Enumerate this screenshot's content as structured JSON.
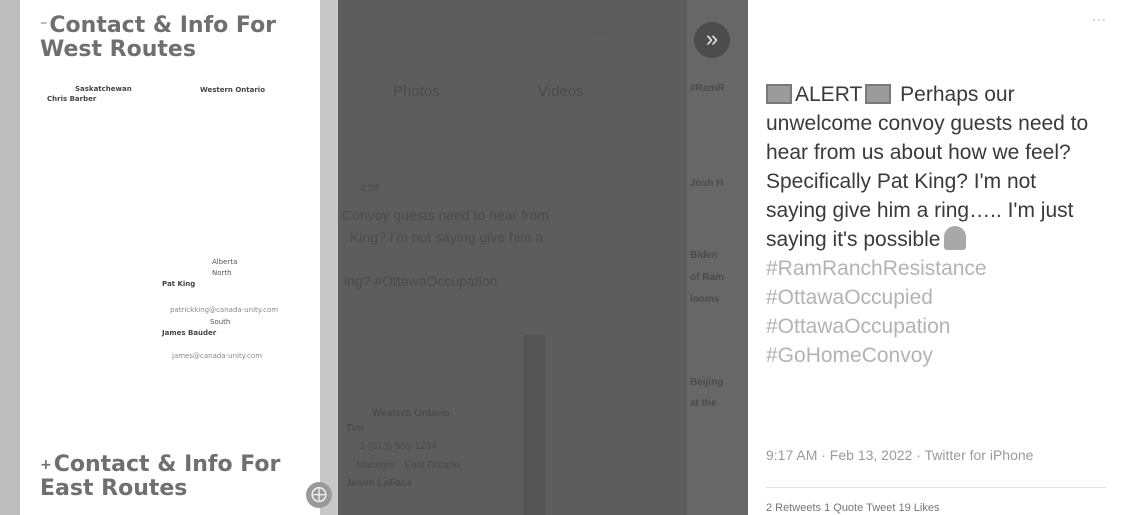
{
  "left_doc": {
    "west_sign": "⁻",
    "west_heading_line1": "Contact & Info For",
    "west_heading_line2": "West Routes",
    "saskatchewan": "Saskatchewan",
    "chris_barber": "Chris Barber",
    "western_ontario": "Western Ontario",
    "alberta": "Alberta",
    "north": "North",
    "pat_king": "Pat King",
    "pat_email": "patrickking@canada-unity.com",
    "south": "South",
    "james_bauder": "James Bauder",
    "james_email": "james@canada-unity.com",
    "east_sign": "+",
    "east_heading_line1": "Contact & Info For",
    "east_heading_line2": "East Routes",
    "circle_icon_name": "close-circle-icon"
  },
  "mid_panel": {
    "tab_left": "Photos",
    "tab_right": "Videos",
    "more_dots": "···",
    "snippet_line1": "Convoy guests need to hear from",
    "snippet_line2": "King? I'm not saying give him a",
    "snippet_line3": "ing? #OttawaOccupation",
    "small_note": "4:08",
    "western_ontario": "Western Ontario",
    "row_label": "Tim",
    "row_phone": "1 (613) 555-1234",
    "row_region": "Manager · East Ontario",
    "row_name": "Jason LaFace",
    "sidebar_1": "#RamR",
    "sidebar_2": "Josh H",
    "sidebar_3": "Biden",
    "sidebar_4": "of Ram",
    "sidebar_5": "looms",
    "sidebar_6": "Beijing",
    "sidebar_7": "at the",
    "chevron_icon_name": "double-chevron-right-icon"
  },
  "tweet": {
    "more_dots": "···",
    "alert_word": "ALERT",
    "text_after_alert": "Perhaps our unwelcome convoy guests need to hear from us about how we feel? Specifically Pat King? I'm not saying give him a ring….. I'm just saying it's possible",
    "hashtags": [
      "#RamRanchResistance",
      "#OttawaOccupied",
      "#OttawaOccupation",
      "#GoHomeConvoy"
    ],
    "meta": "9:17 AM · Feb 13, 2022 · Twitter for iPhone",
    "stats": "2 Retweets   1 Quote Tweet   19 Likes",
    "alert_icon_name": "alert-siren-icon",
    "ghost_icon_name": "ghost-icon"
  },
  "colors": {
    "heading_gray": "#6f6f6f",
    "hashtag_gray": "#b3b3b3",
    "dim_overlay": "#5d5d5d"
  }
}
